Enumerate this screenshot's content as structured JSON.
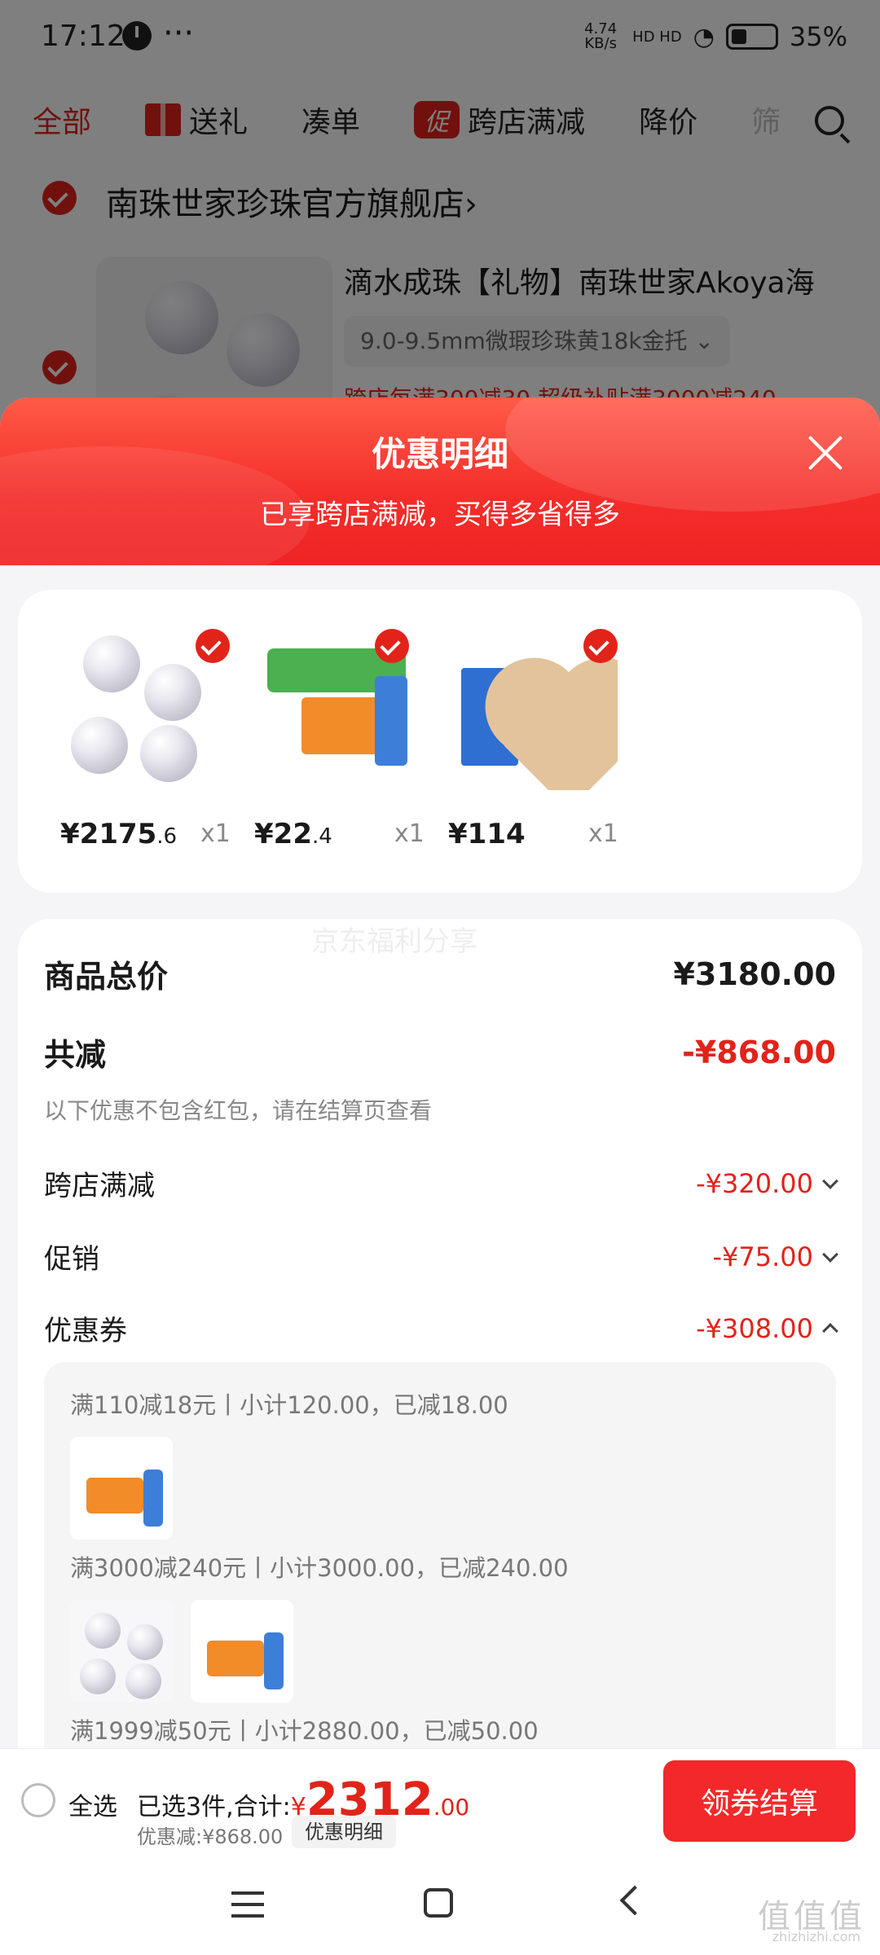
{
  "status_bar": {
    "time": "17:12",
    "more": "···",
    "net_speed": "4.74 KB/s",
    "signal": "HD HD",
    "battery": "35%"
  },
  "tabs": [
    {
      "label": "全部"
    },
    {
      "label": "送礼"
    },
    {
      "label": "凑单"
    },
    {
      "label": "跨店满减",
      "badge": "促"
    },
    {
      "label": "降价"
    },
    {
      "label": "筛"
    }
  ],
  "store": {
    "name": "南珠世家珍珠官方旗舰店",
    "chevron": "›",
    "product_title": "滴水成珠【礼物】南珠世家Akoya海",
    "spec": "9.0-9.5mm微瑕珍珠黄18k金托 ⌄",
    "promo": "跨店每满300减30  超级补贴满3000减240"
  },
  "sheet": {
    "title": "优惠明细",
    "subtitle": "已享跨店满减，买得多省得多"
  },
  "items": [
    {
      "price_int": "¥2175",
      "price_dec": ".6",
      "qty": "x1"
    },
    {
      "price_int": "¥22",
      "price_dec": ".4",
      "qty": "x1"
    },
    {
      "price_int": "¥114",
      "price_dec": "",
      "qty": "x1"
    }
  ],
  "summary": {
    "watermark": "京东福利分享",
    "total_label": "商品总价",
    "total_value": "¥3180.00",
    "reduce_label": "共减",
    "reduce_value": "-¥868.00",
    "note": "以下优惠不包含红包，请在结算页查看",
    "lines": [
      {
        "label": "跨店满减",
        "value": "-¥320.00"
      },
      {
        "label": "促销",
        "value": "-¥75.00"
      },
      {
        "label": "优惠券",
        "value": "-¥308.00"
      }
    ],
    "coupons": [
      "满110减18元丨小计120.00，已减18.00",
      "满3000减240元丨小计3000.00，已减240.00",
      "满1999减50元丨小计2880.00，已减50.00"
    ]
  },
  "bottom": {
    "select_all": "全选",
    "selected_prefix": "已选3件,合计:",
    "yen": "¥",
    "total_int": "2312",
    "total_dec": ".00",
    "discount": "优惠减:¥868.00",
    "detail_btn": "优惠明细",
    "pay_btn": "领券结算"
  },
  "watermark": {
    "logo": "值值值",
    "url": "zhizhizhi.com"
  },
  "colors": {
    "accent": "#e2231a",
    "sheet_header": "#f42d2a"
  }
}
